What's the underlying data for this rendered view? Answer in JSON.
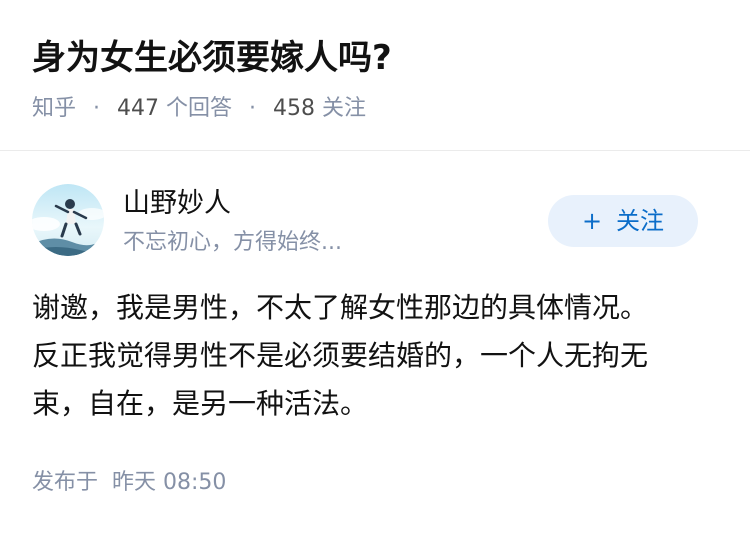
{
  "question": {
    "title": "身为女生必须要嫁人吗?",
    "source": "知乎",
    "answer_count": "447",
    "answer_label": "个回答",
    "follower_count": "458",
    "follower_label": "关注"
  },
  "answer": {
    "author": {
      "name": "山野妙人",
      "bio": "不忘初心，方得始终..."
    },
    "follow_button": {
      "icon": "plus-icon",
      "label": "关注"
    },
    "content_lines": [
      "谢邀，我是男性，不太了解女性那边的具体情况。",
      "反正我觉得男性不是必须要结婚的，一个人无拘无",
      "束，自在，是另一种活法。"
    ],
    "footer": {
      "published_label": "发布于",
      "published_time": "昨天 08:50"
    }
  },
  "colors": {
    "text_primary": "#121212",
    "text_secondary": "#8590a6",
    "accent_blue": "#0b6dc9",
    "button_bg": "#e8f1fc",
    "divider": "#ebebeb"
  }
}
